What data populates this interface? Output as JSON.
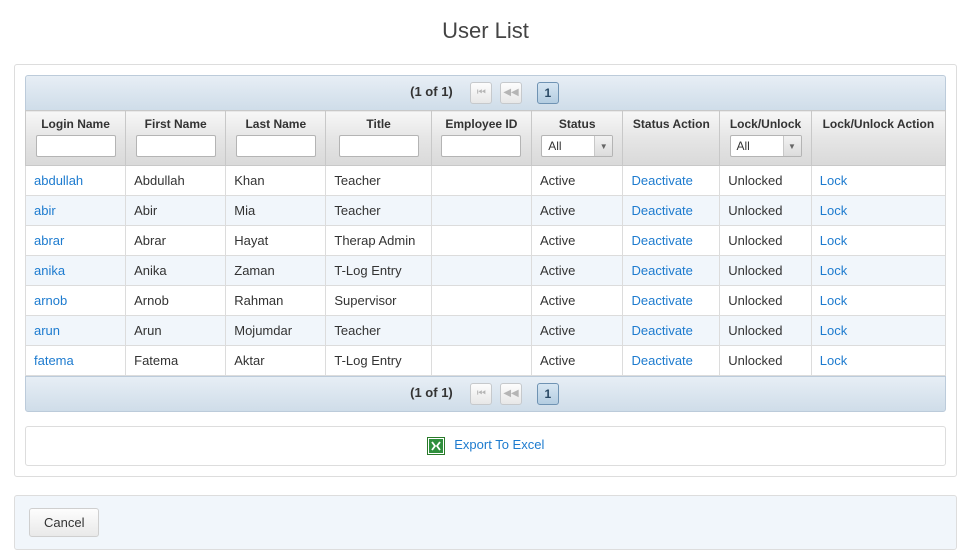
{
  "page_title": "User List",
  "paginator": {
    "label": "(1 of 1)",
    "current_page": "1"
  },
  "columns": {
    "login_name": "Login Name",
    "first_name": "First Name",
    "last_name": "Last Name",
    "title": "Title",
    "employee_id": "Employee ID",
    "status": "Status",
    "status_action": "Status Action",
    "lock_unlock": "Lock/Unlock",
    "lock_unlock_action": "Lock/Unlock Action"
  },
  "filters": {
    "status_selected": "All",
    "lock_selected": "All"
  },
  "rows": [
    {
      "login": "abdullah",
      "first": "Abdullah",
      "last": "Khan",
      "title": "Teacher",
      "emp": "",
      "status": "Active",
      "status_action": "Deactivate",
      "lock": "Unlocked",
      "lock_action": "Lock"
    },
    {
      "login": "abir",
      "first": "Abir",
      "last": "Mia",
      "title": "Teacher",
      "emp": "",
      "status": "Active",
      "status_action": "Deactivate",
      "lock": "Unlocked",
      "lock_action": "Lock"
    },
    {
      "login": "abrar",
      "first": "Abrar",
      "last": "Hayat",
      "title": "Therap Admin",
      "emp": "",
      "status": "Active",
      "status_action": "Deactivate",
      "lock": "Unlocked",
      "lock_action": "Lock"
    },
    {
      "login": "anika",
      "first": "Anika",
      "last": "Zaman",
      "title": "T-Log Entry",
      "emp": "",
      "status": "Active",
      "status_action": "Deactivate",
      "lock": "Unlocked",
      "lock_action": "Lock"
    },
    {
      "login": "arnob",
      "first": "Arnob",
      "last": "Rahman",
      "title": "Supervisor",
      "emp": "",
      "status": "Active",
      "status_action": "Deactivate",
      "lock": "Unlocked",
      "lock_action": "Lock"
    },
    {
      "login": "arun",
      "first": "Arun",
      "last": "Mojumdar",
      "title": "Teacher",
      "emp": "",
      "status": "Active",
      "status_action": "Deactivate",
      "lock": "Unlocked",
      "lock_action": "Lock"
    },
    {
      "login": "fatema",
      "first": "Fatema",
      "last": "Aktar",
      "title": "T-Log Entry",
      "emp": "",
      "status": "Active",
      "status_action": "Deactivate",
      "lock": "Unlocked",
      "lock_action": "Lock"
    }
  ],
  "export_label": "Export To Excel",
  "cancel_label": "Cancel"
}
